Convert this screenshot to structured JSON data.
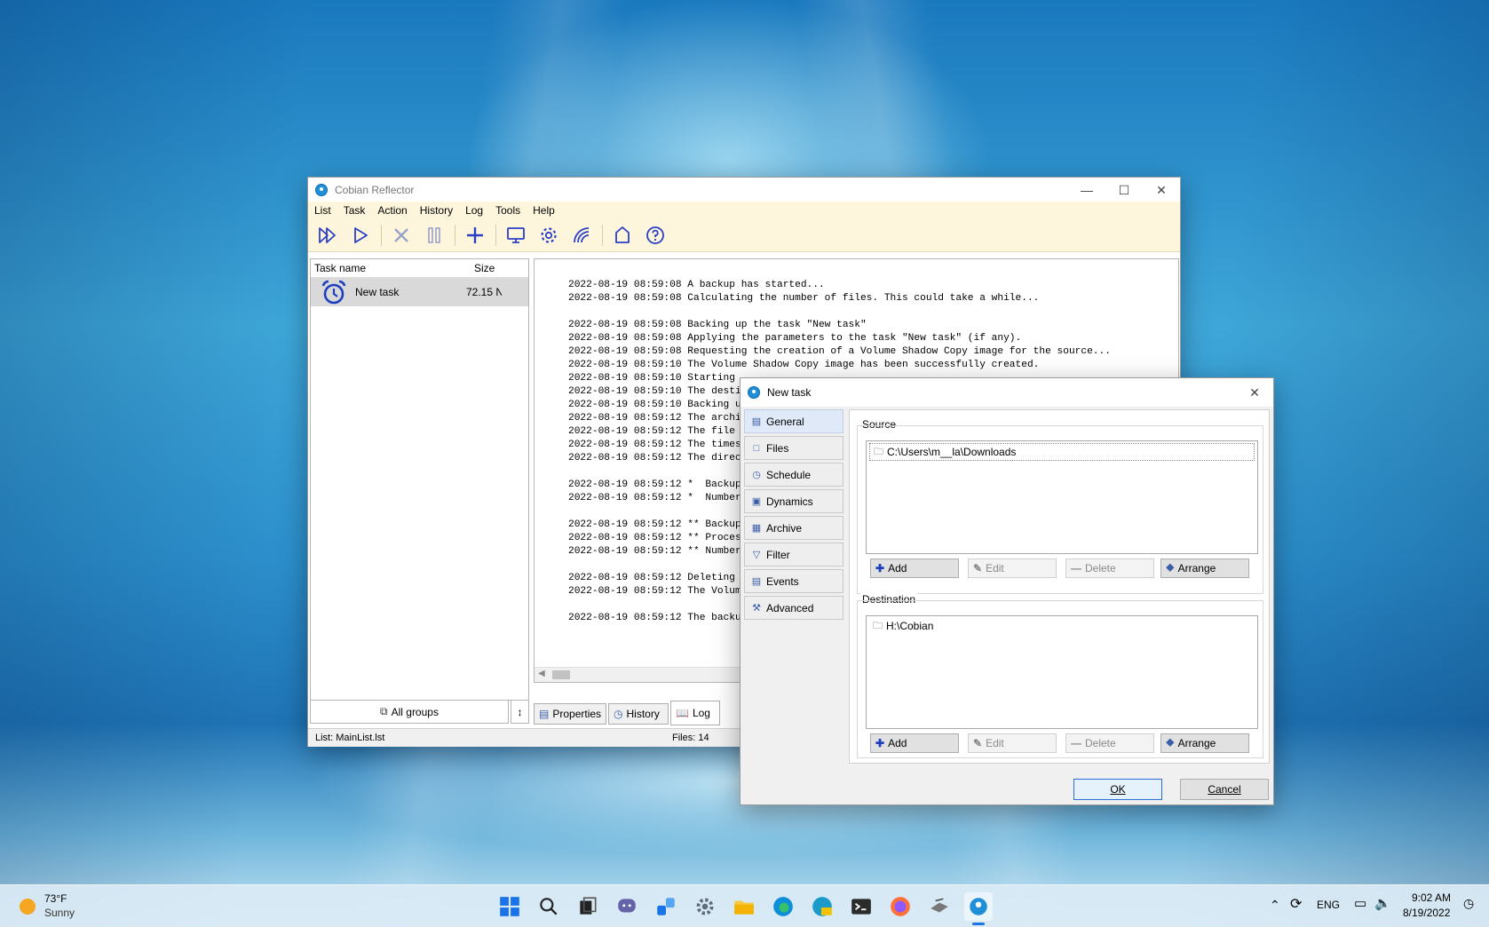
{
  "main_window": {
    "title": "Cobian Reflector",
    "menu": [
      "List",
      "Task",
      "Action",
      "History",
      "Log",
      "Tools",
      "Help"
    ],
    "toolbar_icons": [
      "run-all-icon",
      "run-icon",
      "stop-icon",
      "pause-icon",
      "add-task-icon",
      "monitor-icon",
      "settings-gear-icon",
      "signal-icon",
      "home-icon",
      "help-icon"
    ],
    "task_list": {
      "col_name": "Task name",
      "col_size": "Size",
      "tasks": [
        {
          "name": "New task",
          "size": "72.15 N"
        }
      ]
    },
    "log_lines": [
      "2022-08-19 08:59:08 A backup has started...",
      "2022-08-19 08:59:08 Calculating the number of files. This could take a while...",
      "",
      "2022-08-19 08:59:08 Backing up the task \"New task\"",
      "2022-08-19 08:59:08 Applying the parameters to the task \"New task\" (if any).",
      "2022-08-19 08:59:08 Requesting the creation of a Volume Shadow Copy image for the source...",
      "2022-08-19 08:59:10 The Volume Shadow Copy image has been successfully created.",
      "2022-08-19 08:59:10 Starting",
      "2022-08-19 08:59:10 The desti",
      "2022-08-19 08:59:10 Backing u",
      "2022-08-19 08:59:12 The archi",
      "2022-08-19 08:59:12 The file",
      "2022-08-19 08:59:12 The times",
      "2022-08-19 08:59:12 The direc",
      "",
      "2022-08-19 08:59:12 *  Backup",
      "2022-08-19 08:59:12 *  Number",
      "",
      "2022-08-19 08:59:12 ** Backup",
      "2022-08-19 08:59:12 ** Proces",
      "2022-08-19 08:59:12 ** Number",
      "",
      "2022-08-19 08:59:12 Deleting",
      "2022-08-19 08:59:12 The Volum",
      "",
      "2022-08-19 08:59:12 The backu"
    ],
    "groups_button": "All groups",
    "bottom_tabs": [
      "Properties",
      "History",
      "Log"
    ],
    "status_list": "List: MainList.lst",
    "status_files": "Files: 14"
  },
  "dialog": {
    "title": "New task",
    "tabs": [
      "General",
      "Files",
      "Schedule",
      "Dynamics",
      "Archive",
      "Filter",
      "Events",
      "Advanced"
    ],
    "source_label": "Source",
    "source_items": [
      "C:\\Users\\m__la\\Downloads"
    ],
    "destination_label": "Destination",
    "destination_items": [
      "H:\\Cobian"
    ],
    "buttons": {
      "add": "Add",
      "edit": "Edit",
      "delete": "Delete",
      "arrange": "Arrange"
    },
    "ok": "OK",
    "cancel": "Cancel"
  },
  "taskbar": {
    "weather_temp": "73°F",
    "weather_desc": "Sunny",
    "apps": [
      "start-icon",
      "search-icon",
      "task-view-icon",
      "chat-icon",
      "widgets-icon",
      "settings-icon",
      "file-explorer-icon",
      "edge-icon",
      "edge-canary-icon",
      "terminal-icon",
      "firefox-icon",
      "app-icon",
      "cobian-icon"
    ],
    "language": "ENG",
    "time": "9:02 AM",
    "date": "8/19/2022"
  },
  "colors": {
    "accent": "#1f3fbf",
    "menu_bg": "#fdf6dc",
    "selection": "#d9d9d9"
  }
}
